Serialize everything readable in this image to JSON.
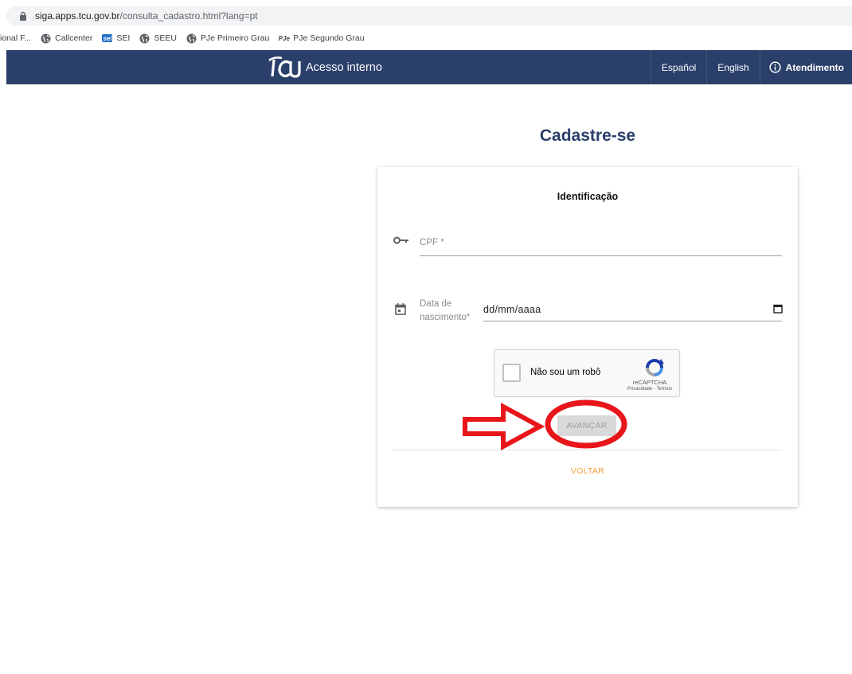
{
  "browser": {
    "url_host": "siga.apps.tcu.gov.br",
    "url_path": "/consulta_cadastro.html?lang=pt",
    "bookmarks": [
      {
        "label": "ional F...",
        "icon": "none"
      },
      {
        "label": "Callcenter",
        "icon": "globe-icon"
      },
      {
        "label": "SEI",
        "icon": "sei-icon",
        "icon_text": "sei"
      },
      {
        "label": "SEEU",
        "icon": "globe-icon"
      },
      {
        "label": "PJe Primeiro Grau",
        "icon": "globe-icon"
      },
      {
        "label": "PJe Segundo Grau",
        "icon": "pje-icon",
        "icon_text": "PJe"
      }
    ]
  },
  "header": {
    "brand": "Acesso interno",
    "nav": [
      {
        "label": "Español"
      },
      {
        "label": "English"
      },
      {
        "label": "Atendimento",
        "icon": "info-icon"
      }
    ],
    "bg_color": "#2b3f6b"
  },
  "page": {
    "title": "Cadastre-se"
  },
  "form": {
    "section_title": "Identificação",
    "cpf": {
      "label": "CPF *",
      "icon": "key-icon"
    },
    "birthdate": {
      "label_line1": "Data de",
      "label_line2": "nascimento*",
      "value": "dd/mm/aaaa",
      "icon": "calendar-icon"
    },
    "captcha": {
      "label": "Não sou um robô",
      "brand": "reCAPTCHA",
      "links": "Privacidade - Termos"
    },
    "next_button": "AVANÇAR",
    "back_button": "VOLTAR",
    "back_color": "#f2a03d"
  },
  "annotation": {
    "color": "#e8161b"
  }
}
